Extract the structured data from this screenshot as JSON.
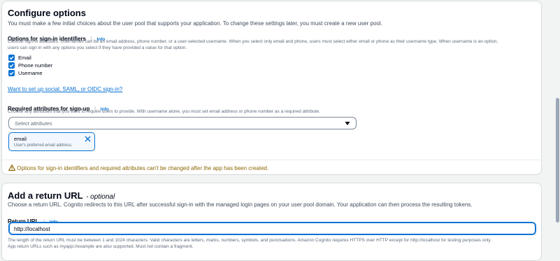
{
  "configure": {
    "title": "Configure options",
    "description": "You must make a few initial choices about the user pool that supports your application. To change these settings later, you must create a new user pool.",
    "signin": {
      "label": "Options for sign-in identifiers",
      "info": "Info",
      "help_line1": "Choose sign-in attributes. Usernames can be an email address, phone number, or a user-selected username. When you select only email and phone, users must select either email or phone as their username type. When username is an option,",
      "help_line2": "users can sign in with any options you select if they have provided a value for that option.",
      "options": [
        {
          "label": "Email",
          "checked": true
        },
        {
          "label": "Phone number",
          "checked": true
        },
        {
          "label": "Username",
          "checked": true
        }
      ]
    },
    "social_link": "Want to set up social, SAML, or OIDC sign-in?",
    "required": {
      "label": "Required attributes for sign-up",
      "info": "Info",
      "help": "Choose any attributes that you want to require users to provide. With username alone, you must set email address or phone number as a required attribute.",
      "select_placeholder": "Select attributes",
      "token": {
        "name": "email",
        "description": "User's preferred email address."
      }
    },
    "warning": "Options for sign-in identifiers and required attributes can't be changed after the app has been created."
  },
  "return_url": {
    "title": "Add a return URL",
    "title_suffix": "- optional",
    "description": "Choose a return URL. Cognito redirects to this URL after successful sign-in with the managed login pages on your user pool domain. Your application can then process the resulting tokens.",
    "label": "Return URL",
    "info": "Info",
    "value": "http://localhost",
    "help_line1": "The length of the return URL must be between 1 and 1024 characters. Valid characters are letters, marks, numbers, symbols, and punctuations. Amazon Cognito requires HTTPS over HTTP except for http://localhost for testing purposes only.",
    "help_line2": "App return URLs such as myapp://example are also supported. Must not contain a fragment."
  },
  "colors": {
    "accent": "#0972d3",
    "warning": "#8d6605",
    "text": "#000716"
  },
  "icons": {
    "checkbox": "check-icon",
    "dropdown": "caret-down-icon",
    "token_remove": "close-icon",
    "warning": "warning-icon"
  }
}
